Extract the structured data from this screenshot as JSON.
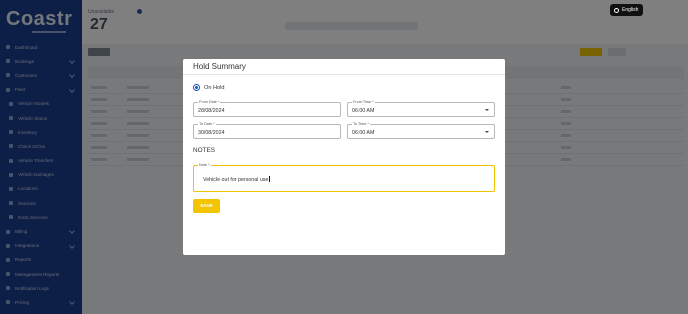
{
  "app": {
    "logo_text": "Coastr"
  },
  "sidebar": {
    "items": [
      {
        "label": "Dashboard"
      },
      {
        "label": "Bookings"
      },
      {
        "label": "Customers"
      },
      {
        "label": "Fleet"
      },
      {
        "label": "Vehicle Models"
      },
      {
        "label": "Vehicle Status"
      },
      {
        "label": "Inventory"
      },
      {
        "label": "Check In/Out"
      },
      {
        "label": "Vehicle Transfers"
      },
      {
        "label": "Vehicle Damages"
      },
      {
        "label": "Locations"
      },
      {
        "label": "Services"
      },
      {
        "label": "Extra Services"
      },
      {
        "label": "Billing"
      },
      {
        "label": "Integrations"
      },
      {
        "label": "Reports"
      },
      {
        "label": "Management Reports"
      },
      {
        "label": "Notification Logs"
      },
      {
        "label": "Pricing"
      }
    ]
  },
  "page": {
    "title": "Unavailable",
    "count": "27"
  },
  "header": {
    "language_label": "English"
  },
  "modal": {
    "title": "Hold Summary",
    "status_option": "On Hold",
    "from_date": {
      "label": "From Date *",
      "value": "28/08/2024"
    },
    "from_time": {
      "label": "From Time *",
      "value": "06:00 AM"
    },
    "to_date": {
      "label": "To Date *",
      "value": "30/08/2024"
    },
    "to_time": {
      "label": "To Time *",
      "value": "06:00 AM"
    },
    "notes_title": "NOTES",
    "note": {
      "label": "Note *",
      "value": "Vehicle out for personal use"
    },
    "save_label": "SAVE"
  }
}
